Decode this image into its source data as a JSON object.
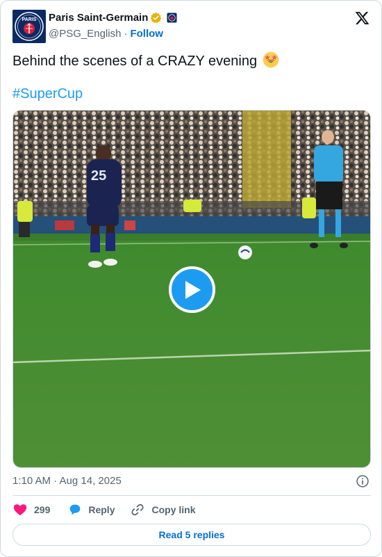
{
  "author": {
    "display_name": "Paris Saint-Germain",
    "handle": "@PSG_English",
    "separator": "·",
    "follow_label": "Follow",
    "avatar_text": "PARIS",
    "verified_color": "#e8b308"
  },
  "tweet": {
    "text": "Behind the scenes of a CRAZY evening",
    "emoji": "star-struck",
    "hashtag": "#SuperCup"
  },
  "media": {
    "type": "video",
    "player_number": "25"
  },
  "meta": {
    "timestamp": "1:10 AM · Aug 14, 2025"
  },
  "actions": {
    "likes_count": "299",
    "reply_label": "Reply",
    "copy_label": "Copy link"
  },
  "footer": {
    "read_replies_label": "Read 5 replies"
  },
  "colors": {
    "accent": "#1d9bf0",
    "link": "#006fd6",
    "heart": "#f91880",
    "psg_navy": "#0b2a63"
  }
}
